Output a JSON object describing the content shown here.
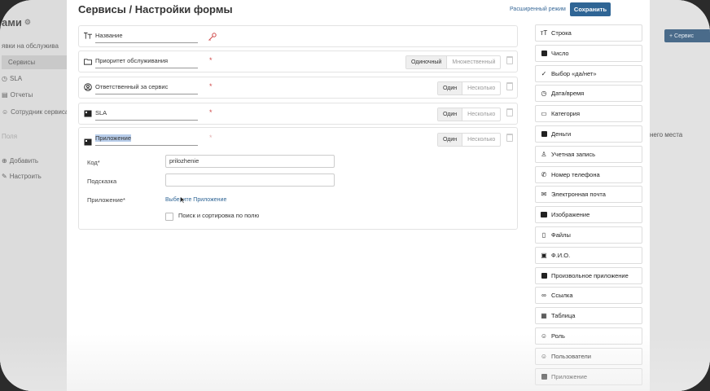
{
  "sidebar": {
    "brand": "ами",
    "items": [
      {
        "label": "явки на обслужива"
      },
      {
        "label": "Сервисы"
      },
      {
        "label": "SLA"
      },
      {
        "label": "Отчеты"
      },
      {
        "label": "Сотрудник сервиса"
      },
      {
        "label": "Поля"
      },
      {
        "label": "Добавить"
      },
      {
        "label": "Настроить"
      }
    ]
  },
  "background": {
    "right_button": "+ Сервис",
    "right_text": "него места"
  },
  "header": {
    "title": "Сервисы / Настройки формы",
    "advanced_mode": "Расширенный режим",
    "save_label": "Сохранить"
  },
  "fields": [
    {
      "label": "Название",
      "icon": "text-icon",
      "required": false,
      "options": []
    },
    {
      "label": "Приоритет обслуживания",
      "icon": "folder-icon",
      "required": true,
      "options": [
        "Одиночный",
        "Множественный"
      ]
    },
    {
      "label": "Ответственный за сервис",
      "icon": "user-circle-icon",
      "required": true,
      "options": [
        "Один",
        "Несколько"
      ]
    },
    {
      "label": "SLA",
      "icon": "app-icon",
      "required": true,
      "options": [
        "Один",
        "Несколько"
      ]
    },
    {
      "label": "Приложение",
      "icon": "app-icon",
      "required": true,
      "options": [
        "Один",
        "Несколько"
      ]
    }
  ],
  "expanded": {
    "code_label": "Код*",
    "code_value": "prilozhenie",
    "hint_label": "Подсказка",
    "hint_value": "",
    "app_label": "Приложение*",
    "app_link": "Выберите Приложение",
    "search_label": "Поиск и сортировка по полю"
  },
  "required_mark": "*",
  "palette": [
    {
      "label": "Строка",
      "icon": "text-icon"
    },
    {
      "label": "Число",
      "icon": "number-icon"
    },
    {
      "label": "Выбор «да/нет»",
      "icon": "check-icon"
    },
    {
      "label": "Дата/время",
      "icon": "clock-icon"
    },
    {
      "label": "Категория",
      "icon": "folder-icon"
    },
    {
      "label": "Деньги",
      "icon": "money-icon"
    },
    {
      "label": "Учетная запись",
      "icon": "user-icon"
    },
    {
      "label": "Номер телефона",
      "icon": "phone-icon"
    },
    {
      "label": "Электронная почта",
      "icon": "mail-icon"
    },
    {
      "label": "Изображение",
      "icon": "image-icon"
    },
    {
      "label": "Файлы",
      "icon": "file-icon"
    },
    {
      "label": "Ф.И.О.",
      "icon": "id-card-icon"
    },
    {
      "label": "Произвольное приложение",
      "icon": "app-icon"
    },
    {
      "label": "Ссылка",
      "icon": "link-icon"
    },
    {
      "label": "Таблица",
      "icon": "table-icon"
    },
    {
      "label": "Роль",
      "icon": "user-circle-icon"
    },
    {
      "label": "Пользователи",
      "icon": "user-circle-icon"
    },
    {
      "label": "Приложение",
      "icon": "app-icon"
    }
  ],
  "colors": {
    "accent": "#2f6595",
    "required": "#d04a4a",
    "selection": "#b8cdea"
  }
}
